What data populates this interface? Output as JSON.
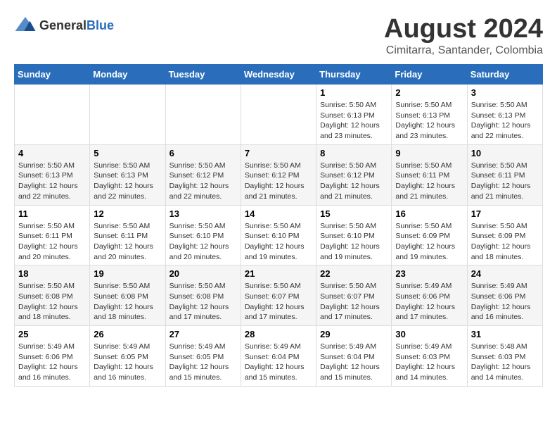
{
  "header": {
    "logo_general": "General",
    "logo_blue": "Blue",
    "title": "August 2024",
    "subtitle": "Cimitarra, Santander, Colombia"
  },
  "days_of_week": [
    "Sunday",
    "Monday",
    "Tuesday",
    "Wednesday",
    "Thursday",
    "Friday",
    "Saturday"
  ],
  "weeks": [
    [
      {
        "day": "",
        "info": ""
      },
      {
        "day": "",
        "info": ""
      },
      {
        "day": "",
        "info": ""
      },
      {
        "day": "",
        "info": ""
      },
      {
        "day": "1",
        "info": "Sunrise: 5:50 AM\nSunset: 6:13 PM\nDaylight: 12 hours\nand 23 minutes."
      },
      {
        "day": "2",
        "info": "Sunrise: 5:50 AM\nSunset: 6:13 PM\nDaylight: 12 hours\nand 23 minutes."
      },
      {
        "day": "3",
        "info": "Sunrise: 5:50 AM\nSunset: 6:13 PM\nDaylight: 12 hours\nand 22 minutes."
      }
    ],
    [
      {
        "day": "4",
        "info": "Sunrise: 5:50 AM\nSunset: 6:13 PM\nDaylight: 12 hours\nand 22 minutes."
      },
      {
        "day": "5",
        "info": "Sunrise: 5:50 AM\nSunset: 6:13 PM\nDaylight: 12 hours\nand 22 minutes."
      },
      {
        "day": "6",
        "info": "Sunrise: 5:50 AM\nSunset: 6:12 PM\nDaylight: 12 hours\nand 22 minutes."
      },
      {
        "day": "7",
        "info": "Sunrise: 5:50 AM\nSunset: 6:12 PM\nDaylight: 12 hours\nand 21 minutes."
      },
      {
        "day": "8",
        "info": "Sunrise: 5:50 AM\nSunset: 6:12 PM\nDaylight: 12 hours\nand 21 minutes."
      },
      {
        "day": "9",
        "info": "Sunrise: 5:50 AM\nSunset: 6:11 PM\nDaylight: 12 hours\nand 21 minutes."
      },
      {
        "day": "10",
        "info": "Sunrise: 5:50 AM\nSunset: 6:11 PM\nDaylight: 12 hours\nand 21 minutes."
      }
    ],
    [
      {
        "day": "11",
        "info": "Sunrise: 5:50 AM\nSunset: 6:11 PM\nDaylight: 12 hours\nand 20 minutes."
      },
      {
        "day": "12",
        "info": "Sunrise: 5:50 AM\nSunset: 6:11 PM\nDaylight: 12 hours\nand 20 minutes."
      },
      {
        "day": "13",
        "info": "Sunrise: 5:50 AM\nSunset: 6:10 PM\nDaylight: 12 hours\nand 20 minutes."
      },
      {
        "day": "14",
        "info": "Sunrise: 5:50 AM\nSunset: 6:10 PM\nDaylight: 12 hours\nand 19 minutes."
      },
      {
        "day": "15",
        "info": "Sunrise: 5:50 AM\nSunset: 6:10 PM\nDaylight: 12 hours\nand 19 minutes."
      },
      {
        "day": "16",
        "info": "Sunrise: 5:50 AM\nSunset: 6:09 PM\nDaylight: 12 hours\nand 19 minutes."
      },
      {
        "day": "17",
        "info": "Sunrise: 5:50 AM\nSunset: 6:09 PM\nDaylight: 12 hours\nand 18 minutes."
      }
    ],
    [
      {
        "day": "18",
        "info": "Sunrise: 5:50 AM\nSunset: 6:08 PM\nDaylight: 12 hours\nand 18 minutes."
      },
      {
        "day": "19",
        "info": "Sunrise: 5:50 AM\nSunset: 6:08 PM\nDaylight: 12 hours\nand 18 minutes."
      },
      {
        "day": "20",
        "info": "Sunrise: 5:50 AM\nSunset: 6:08 PM\nDaylight: 12 hours\nand 17 minutes."
      },
      {
        "day": "21",
        "info": "Sunrise: 5:50 AM\nSunset: 6:07 PM\nDaylight: 12 hours\nand 17 minutes."
      },
      {
        "day": "22",
        "info": "Sunrise: 5:50 AM\nSunset: 6:07 PM\nDaylight: 12 hours\nand 17 minutes."
      },
      {
        "day": "23",
        "info": "Sunrise: 5:49 AM\nSunset: 6:06 PM\nDaylight: 12 hours\nand 17 minutes."
      },
      {
        "day": "24",
        "info": "Sunrise: 5:49 AM\nSunset: 6:06 PM\nDaylight: 12 hours\nand 16 minutes."
      }
    ],
    [
      {
        "day": "25",
        "info": "Sunrise: 5:49 AM\nSunset: 6:06 PM\nDaylight: 12 hours\nand 16 minutes."
      },
      {
        "day": "26",
        "info": "Sunrise: 5:49 AM\nSunset: 6:05 PM\nDaylight: 12 hours\nand 16 minutes."
      },
      {
        "day": "27",
        "info": "Sunrise: 5:49 AM\nSunset: 6:05 PM\nDaylight: 12 hours\nand 15 minutes."
      },
      {
        "day": "28",
        "info": "Sunrise: 5:49 AM\nSunset: 6:04 PM\nDaylight: 12 hours\nand 15 minutes."
      },
      {
        "day": "29",
        "info": "Sunrise: 5:49 AM\nSunset: 6:04 PM\nDaylight: 12 hours\nand 15 minutes."
      },
      {
        "day": "30",
        "info": "Sunrise: 5:49 AM\nSunset: 6:03 PM\nDaylight: 12 hours\nand 14 minutes."
      },
      {
        "day": "31",
        "info": "Sunrise: 5:48 AM\nSunset: 6:03 PM\nDaylight: 12 hours\nand 14 minutes."
      }
    ]
  ]
}
